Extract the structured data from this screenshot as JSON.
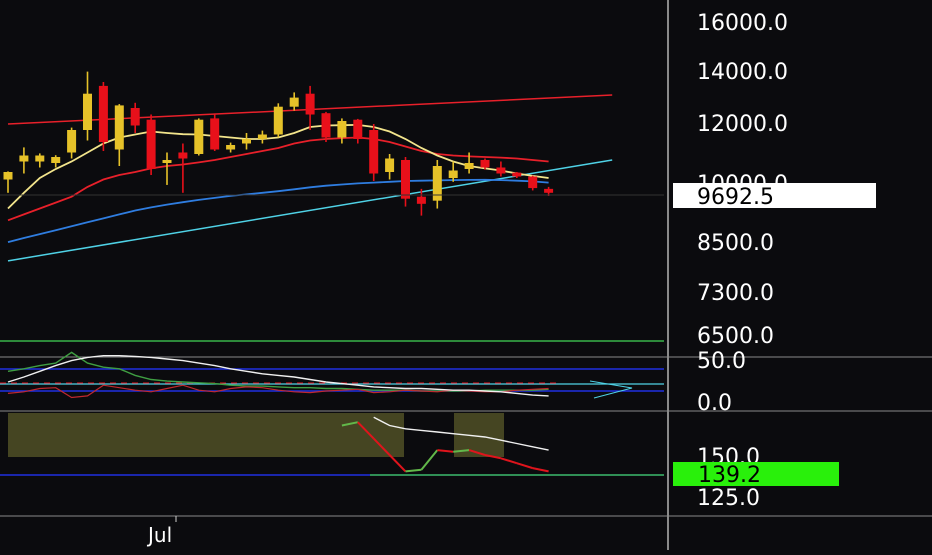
{
  "colors": {
    "background": "#0b0b0e",
    "candle_up": "#e6c229",
    "candle_down": "#e8101a",
    "ma_fast": "#f3e58c",
    "ma_mid": "#e8202a",
    "ma_slow": "#2f7de0",
    "trendline_upper": "#e8202a",
    "trendline_lower": "#4fd2e6",
    "axis_text": "#ffffff",
    "last_price_bg": "#ffffff",
    "last_price_text": "#000000",
    "indicator_label_bg": "#29f00b",
    "indicator_label_text": "#000000",
    "guide_green": "#39b54a",
    "guide_blue": "#1f2fe0",
    "osc_shade": "#5a5a2a"
  },
  "price_axis": {
    "labels": [
      "16000.0",
      "14000.0",
      "12000.0",
      "10000.0",
      "8500.0",
      "7300.0",
      "6500.0"
    ],
    "last_price": "9692.5"
  },
  "indicator1_axis": {
    "labels": [
      "50.0",
      "0.0"
    ]
  },
  "indicator2_axis": {
    "labels": [
      "150.0",
      "125.0"
    ],
    "last_value": "139.2"
  },
  "time_axis": {
    "labels": [
      "Jul"
    ]
  },
  "chart_data": {
    "type": "candlestick",
    "candles": [
      {
        "o": 10050,
        "h": 10320,
        "l": 9700,
        "c": 10300
      },
      {
        "o": 10650,
        "h": 11120,
        "l": 10250,
        "c": 10850
      },
      {
        "o": 10650,
        "h": 10920,
        "l": 10450,
        "c": 10850
      },
      {
        "o": 10600,
        "h": 10860,
        "l": 10450,
        "c": 10800
      },
      {
        "o": 10950,
        "h": 11780,
        "l": 10750,
        "c": 11700
      },
      {
        "o": 11700,
        "h": 13900,
        "l": 11350,
        "c": 13050
      },
      {
        "o": 13350,
        "h": 13500,
        "l": 11000,
        "c": 11300
      },
      {
        "o": 11050,
        "h": 12650,
        "l": 10500,
        "c": 12600
      },
      {
        "o": 12500,
        "h": 12700,
        "l": 11600,
        "c": 11850
      },
      {
        "o": 12050,
        "h": 12250,
        "l": 10200,
        "c": 10400
      },
      {
        "o": 10600,
        "h": 10950,
        "l": 9900,
        "c": 10700
      },
      {
        "o": 10950,
        "h": 11250,
        "l": 9700,
        "c": 10750
      },
      {
        "o": 10900,
        "h": 12100,
        "l": 10850,
        "c": 12050
      },
      {
        "o": 12100,
        "h": 12250,
        "l": 11000,
        "c": 11050
      },
      {
        "o": 11050,
        "h": 11280,
        "l": 10950,
        "c": 11200
      },
      {
        "o": 11250,
        "h": 11600,
        "l": 11050,
        "c": 11400
      },
      {
        "o": 11400,
        "h": 11680,
        "l": 11250,
        "c": 11550
      },
      {
        "o": 11550,
        "h": 12680,
        "l": 11450,
        "c": 12550
      },
      {
        "o": 12550,
        "h": 13100,
        "l": 12400,
        "c": 12900
      },
      {
        "o": 13050,
        "h": 13350,
        "l": 11700,
        "c": 12250
      },
      {
        "o": 12300,
        "h": 12350,
        "l": 11300,
        "c": 11450
      },
      {
        "o": 11450,
        "h": 12100,
        "l": 11250,
        "c": 12000
      },
      {
        "o": 12050,
        "h": 12080,
        "l": 11250,
        "c": 11400
      },
      {
        "o": 11700,
        "h": 11900,
        "l": 10000,
        "c": 10250
      },
      {
        "o": 10300,
        "h": 10900,
        "l": 10050,
        "c": 10750
      },
      {
        "o": 10700,
        "h": 10800,
        "l": 9350,
        "c": 9550
      },
      {
        "o": 9600,
        "h": 9800,
        "l": 9120,
        "c": 9420
      },
      {
        "o": 9500,
        "h": 10700,
        "l": 9300,
        "c": 10500
      },
      {
        "o": 10100,
        "h": 10650,
        "l": 9980,
        "c": 10350
      },
      {
        "o": 10400,
        "h": 10950,
        "l": 10250,
        "c": 10600
      },
      {
        "o": 10700,
        "h": 10750,
        "l": 10380,
        "c": 10450
      },
      {
        "o": 10450,
        "h": 10650,
        "l": 10150,
        "c": 10250
      },
      {
        "o": 10280,
        "h": 10300,
        "l": 10100,
        "c": 10150
      },
      {
        "o": 10150,
        "h": 10180,
        "l": 9760,
        "c": 9820
      },
      {
        "o": 9800,
        "h": 9850,
        "l": 9620,
        "c": 9700
      }
    ],
    "ma_fast": [
      9300,
      9700,
      10100,
      10400,
      10650,
      10950,
      11250,
      11450,
      11550,
      11650,
      11600,
      11560,
      11550,
      11500,
      11450,
      11400,
      11400,
      11450,
      11600,
      11800,
      11850,
      11860,
      11870,
      11800,
      11650,
      11400,
      11100,
      10850,
      10650,
      10500,
      10420,
      10350,
      10250,
      10170,
      10100
    ],
    "ma_mid": [
      9000,
      9150,
      9300,
      9450,
      9600,
      9850,
      10050,
      10200,
      10300,
      10420,
      10500,
      10550,
      10620,
      10700,
      10800,
      10900,
      11000,
      11100,
      11250,
      11350,
      11400,
      11430,
      11450,
      11400,
      11300,
      11150,
      11000,
      10900,
      10850,
      10820,
      10800,
      10780,
      10750,
      10700,
      10650
    ],
    "ma_slow": [
      8450,
      8550,
      8650,
      8750,
      8850,
      8950,
      9050,
      9150,
      9250,
      9330,
      9400,
      9460,
      9520,
      9570,
      9620,
      9660,
      9700,
      9740,
      9790,
      9840,
      9880,
      9910,
      9940,
      9960,
      9980,
      10000,
      10010,
      10020,
      10030,
      10035,
      10040,
      10030,
      10010,
      9990,
      9960
    ],
    "trendlines": [
      {
        "from": [
          0,
          11900
        ],
        "to": [
          38,
          13000
        ]
      },
      {
        "from": [
          0,
          8000
        ],
        "to": [
          38,
          10700
        ]
      }
    ],
    "indicator1": {
      "y_range": [
        -15,
        60
      ],
      "levels": [
        0,
        50
      ],
      "line_white": [
        22,
        28,
        35,
        42,
        48,
        52,
        54,
        54,
        53,
        52,
        50,
        48,
        45,
        42,
        38,
        35,
        32,
        30,
        28,
        25,
        22,
        20,
        18,
        16,
        15,
        14,
        14,
        13,
        12,
        12,
        11,
        10,
        8,
        6,
        5
      ],
      "line_green": [
        35,
        38,
        42,
        45,
        58,
        45,
        40,
        38,
        30,
        25,
        23,
        22,
        21,
        20,
        18,
        17,
        17,
        16,
        15,
        15,
        14,
        14,
        13,
        12,
        12,
        12,
        11,
        11,
        11,
        11,
        12,
        12,
        12,
        12,
        13
      ],
      "line_red": [
        8,
        10,
        14,
        15,
        3,
        5,
        18,
        15,
        12,
        10,
        14,
        18,
        12,
        10,
        14,
        16,
        15,
        12,
        10,
        9,
        11,
        12,
        13,
        9,
        10,
        12,
        11,
        10,
        12,
        11,
        10,
        10,
        12,
        13,
        14
      ]
    },
    "indicator2": {
      "y_range": [
        115,
        170
      ],
      "levels": [
        139.2
      ],
      "line_white": [
        null,
        null,
        null,
        null,
        null,
        null,
        null,
        null,
        null,
        null,
        null,
        null,
        null,
        null,
        null,
        null,
        null,
        null,
        null,
        null,
        null,
        null,
        null,
        173,
        168,
        166,
        165,
        164,
        163,
        162,
        161,
        159,
        157,
        155,
        153
      ],
      "line_colored": [
        null,
        null,
        null,
        null,
        null,
        null,
        null,
        null,
        null,
        null,
        null,
        null,
        null,
        null,
        null,
        null,
        null,
        null,
        null,
        null,
        null,
        168,
        170,
        160,
        150,
        140,
        141,
        153,
        152,
        153,
        150,
        148,
        145,
        142,
        140
      ]
    }
  }
}
